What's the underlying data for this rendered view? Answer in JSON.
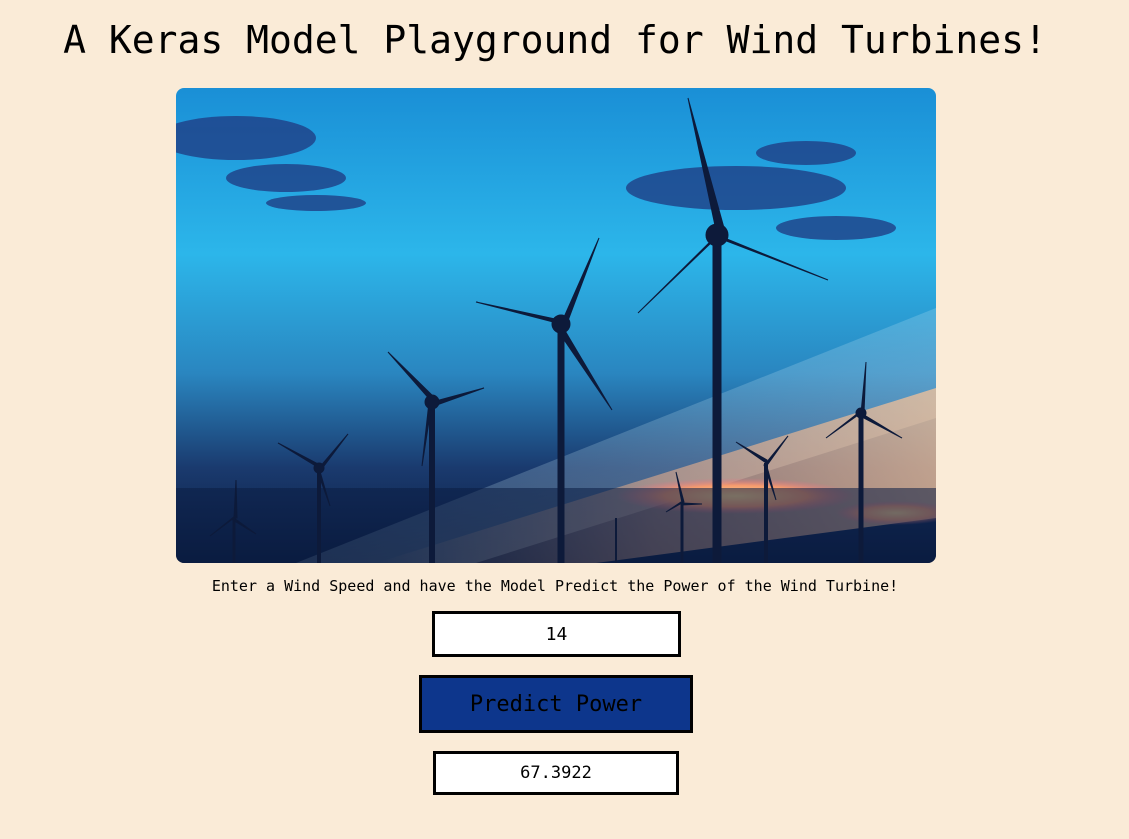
{
  "page": {
    "title": "A Keras Model Playground for Wind Turbines!",
    "background": "#faebd7"
  },
  "hero": {
    "subject": "wind turbines silhouetted against a blue evening sky with sunset clouds"
  },
  "form": {
    "instruction": "Enter a Wind Speed and have the Model Predict the Power of the Wind Turbine!",
    "wind_speed_value": "14",
    "predict_label": "Predict Power",
    "button_color": "#0d368c",
    "result_value": "67.3922"
  }
}
